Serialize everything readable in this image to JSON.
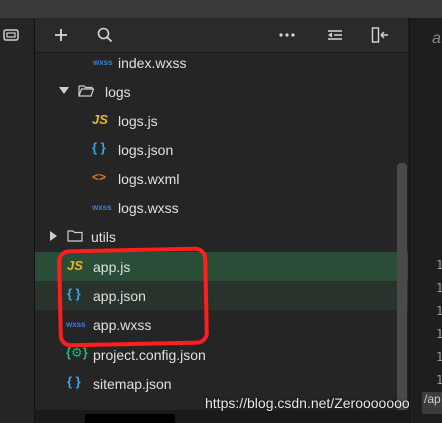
{
  "editor": {
    "tab_glyph": "a",
    "line_numbers": [
      "1",
      "1",
      "1",
      "1",
      "1",
      "1"
    ],
    "path_text": "/ap"
  },
  "tree": [
    {
      "name": "index.wxss",
      "type": "wxss",
      "icon_text": "wxss"
    },
    {
      "name": "logs",
      "type": "folder",
      "expanded": true
    },
    {
      "name": "logs.js",
      "type": "js",
      "icon_text": "JS"
    },
    {
      "name": "logs.json",
      "type": "json",
      "icon_text": "{ }"
    },
    {
      "name": "logs.wxml",
      "type": "wxml",
      "icon_text": "<>"
    },
    {
      "name": "logs.wxss",
      "type": "wxss",
      "icon_text": "wxss"
    },
    {
      "name": "utils",
      "type": "folder",
      "expanded": false
    },
    {
      "name": "app.js",
      "type": "js",
      "icon_text": "JS",
      "selected": true
    },
    {
      "name": "app.json",
      "type": "json",
      "icon_text": "{ }"
    },
    {
      "name": "app.wxss",
      "type": "wxss",
      "icon_text": "wxss"
    },
    {
      "name": "project.config.json",
      "type": "config",
      "icon_text": "{⚙}"
    },
    {
      "name": "sitemap.json",
      "type": "json",
      "icon_text": "{ }"
    }
  ],
  "watermark": "https://blog.csdn.net/Zerooooooo",
  "colors": {
    "selected_row": "#2a4d38",
    "annotation": "#ff1e1e",
    "js_icon": "#e8b731",
    "json_icon": "#3ea4e8",
    "wxss_icon": "#3b7fd6",
    "wxml_icon": "#e0762c"
  },
  "icons": {
    "left_panel": "window-icon",
    "toolbar": [
      "add-icon",
      "search-icon",
      "more-icon",
      "collapse-icon",
      "split-icon"
    ]
  }
}
